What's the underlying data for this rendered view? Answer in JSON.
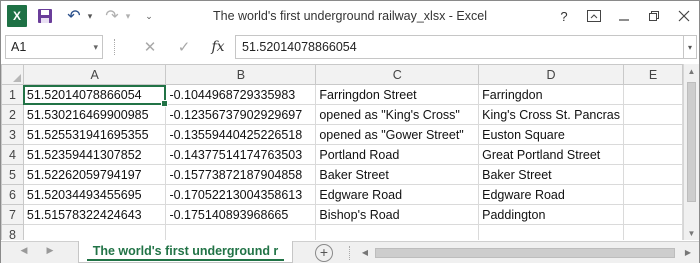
{
  "app": {
    "logo_letter": "X",
    "title": "The world's first underground railway_xlsx - Excel",
    "window_controls": {
      "help": "?",
      "ribbon": "⧉",
      "minimize": "—",
      "restore": "❐",
      "close": "✕"
    },
    "accent_color": "#217346"
  },
  "qat": {
    "undo_icon": "↶",
    "redo_icon": "↷",
    "dropdown_glyph": "▾",
    "customize_glyph": "⌄"
  },
  "formula_bar": {
    "name_box": "A1",
    "cancel_glyph": "✕",
    "enter_glyph": "✓",
    "fx_label": "fx",
    "value": "51.52014078866054",
    "expand_glyph": "▾"
  },
  "grid": {
    "column_headers": [
      "A",
      "B",
      "C",
      "D",
      "E"
    ],
    "row_headers": [
      "1",
      "2",
      "3",
      "4",
      "5",
      "6",
      "7",
      "8"
    ],
    "rows": [
      [
        "51.52014078866054",
        "-0.1044968729335983",
        "Farringdon Street",
        "Farringdon",
        ""
      ],
      [
        "51.530216469900985",
        "-0.12356737902929697",
        "opened as \"King's Cross\"",
        "King's Cross St. Pancras",
        ""
      ],
      [
        "51.525531941695355",
        "-0.13559440425226518",
        "opened as \"Gower Street\"",
        "Euston Square",
        ""
      ],
      [
        "51.52359441307852",
        "-0.14377514174763503",
        "Portland Road",
        "Great Portland Street",
        ""
      ],
      [
        "51.52262059794197",
        "-0.15773872187904858",
        "Baker Street",
        "Baker Street",
        ""
      ],
      [
        "51.52034493455695",
        "-0.17052213004358613",
        "Edgware Road",
        "Edgware Road",
        ""
      ],
      [
        "51.51578322424643",
        "-0.175140893968665",
        "Bishop's Road",
        "Paddington",
        ""
      ],
      [
        "",
        "",
        "",
        "",
        ""
      ]
    ]
  },
  "sheet_tabs": {
    "active": "The world's first underground r",
    "add_glyph": "+",
    "nav_prev": "◀",
    "nav_next": "▶"
  },
  "scroll": {
    "up": "▲",
    "down": "▼",
    "left": "◀",
    "right": "▶"
  }
}
